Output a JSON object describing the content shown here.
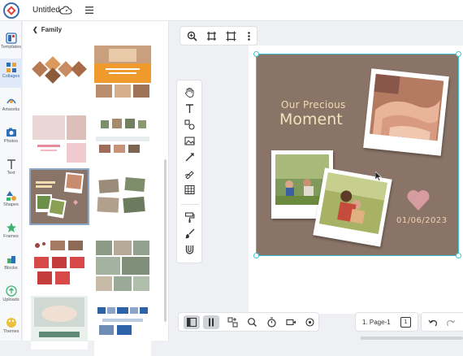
{
  "app": {
    "file_name": "Untitled"
  },
  "rail": {
    "items": [
      {
        "label": "Templates",
        "icon": "templates-icon"
      },
      {
        "label": "Collages",
        "icon": "collages-icon",
        "active": true
      },
      {
        "label": "Artworks",
        "icon": "artworks-icon"
      },
      {
        "label": "Photos",
        "icon": "photos-icon"
      },
      {
        "label": "Text",
        "icon": "text-icon"
      },
      {
        "label": "Shapes",
        "icon": "shapes-icon"
      },
      {
        "label": "Frames",
        "icon": "frames-icon"
      },
      {
        "label": "Blocks",
        "icon": "blocks-icon"
      },
      {
        "label": "Uploads",
        "icon": "uploads-icon"
      },
      {
        "label": "Themes",
        "icon": "themes-icon"
      }
    ]
  },
  "panel": {
    "title": "Family",
    "thumbnails": [
      {
        "name": "collage-family-diamonds"
      },
      {
        "name": "collage-family-orange"
      },
      {
        "name": "collage-baby-pink"
      },
      {
        "name": "collage-family-strip"
      },
      {
        "name": "collage-our-precious-moment",
        "selected": true
      },
      {
        "name": "collage-family-scattered"
      },
      {
        "name": "collage-family-red-frames"
      },
      {
        "name": "collage-family-grid"
      },
      {
        "name": "collage-our-sweet-babies"
      },
      {
        "name": "collage-family-blue"
      }
    ]
  },
  "design": {
    "title_line1": "Our Precious",
    "title_line2": "Moment",
    "date": "01/06/2023",
    "background_color": "#8a7468",
    "selection_color": "#3cc4d6"
  },
  "top_tools": [
    "zoom-in-icon",
    "crop-icon",
    "frame-icon",
    "more-vertical-icon"
  ],
  "side_tools": [
    "hand-icon",
    "text-tool-icon",
    "shapes-tool-icon",
    "image-tool-icon",
    "line-tool-icon",
    "draw-tool-icon",
    "table-tool-icon",
    "paint-roller-icon",
    "brush-icon",
    "magnet-icon"
  ],
  "bottom_tools": [
    "panel-toggle-icon",
    "pages-toggle-icon",
    "layout-icon",
    "zoom-icon",
    "timer-icon",
    "video-icon",
    "settings-icon"
  ],
  "pages": {
    "label": "1. Page-1",
    "count": "1"
  }
}
